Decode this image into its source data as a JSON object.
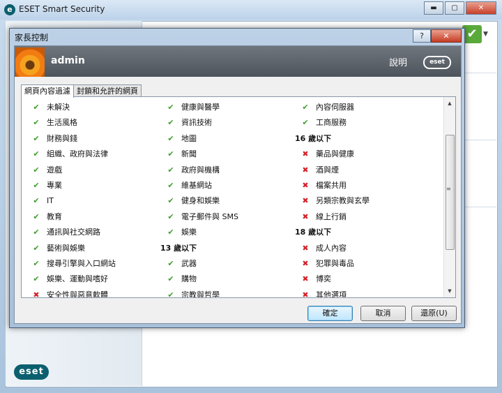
{
  "main_window": {
    "title": "ESET Smart Security",
    "logo_letter": "e",
    "minimize": "▬",
    "maximize": "▢",
    "close": "✕",
    "brand": "eset"
  },
  "dialog": {
    "title": "家長控制",
    "help_button": "?",
    "close_button": "✕",
    "user_name": "admin",
    "help_link": "說明",
    "brand": "eset",
    "tabs": [
      {
        "label": "網頁內容過濾",
        "active": true
      },
      {
        "label": "封鎖和允許的網頁",
        "active": false
      }
    ],
    "columns": [
      [
        {
          "type": "ok",
          "label": "未解決"
        },
        {
          "type": "ok",
          "label": "生活風格"
        },
        {
          "type": "ok",
          "label": "財務與錢"
        },
        {
          "type": "ok",
          "label": "組織、政府與法律"
        },
        {
          "type": "ok",
          "label": "遊戲"
        },
        {
          "type": "ok",
          "label": "專業"
        },
        {
          "type": "ok",
          "label": "IT"
        },
        {
          "type": "ok",
          "label": "教育"
        },
        {
          "type": "ok",
          "label": "通訊與社交網路"
        },
        {
          "type": "ok",
          "label": "藝術與娛樂"
        },
        {
          "type": "ok",
          "label": "搜尋引擎與入口網站"
        },
        {
          "type": "ok",
          "label": "娛樂、運動與嗜好"
        },
        {
          "type": "no",
          "label": "安全性與惡意軟體"
        }
      ],
      [
        {
          "type": "ok",
          "label": "健康與醫學"
        },
        {
          "type": "ok",
          "label": "資訊技術"
        },
        {
          "type": "ok",
          "label": "地圖"
        },
        {
          "type": "ok",
          "label": "新聞"
        },
        {
          "type": "ok",
          "label": "政府與機構"
        },
        {
          "type": "ok",
          "label": "維基網站"
        },
        {
          "type": "ok",
          "label": "健身和娛樂"
        },
        {
          "type": "ok",
          "label": "電子郵件與 SMS"
        },
        {
          "type": "ok",
          "label": "娛樂"
        },
        {
          "type": "hdr",
          "label": "13 歲以下"
        },
        {
          "type": "ok",
          "label": "武器"
        },
        {
          "type": "ok",
          "label": "購物"
        },
        {
          "type": "ok",
          "label": "宗教與哲學"
        }
      ],
      [
        {
          "type": "ok",
          "label": "內容伺服器"
        },
        {
          "type": "ok",
          "label": "工商服務"
        },
        {
          "type": "hdr",
          "label": "16 歲以下"
        },
        {
          "type": "no",
          "label": "藥品與健康"
        },
        {
          "type": "no",
          "label": "酒與煙"
        },
        {
          "type": "no",
          "label": "檔案共用"
        },
        {
          "type": "no",
          "label": "另類宗教與玄學"
        },
        {
          "type": "no",
          "label": "線上行銷"
        },
        {
          "type": "hdr",
          "label": "18 歲以下"
        },
        {
          "type": "no",
          "label": "成人內容"
        },
        {
          "type": "no",
          "label": "犯罪與毒品"
        },
        {
          "type": "no",
          "label": "博奕"
        },
        {
          "type": "no",
          "label": "其他選項"
        }
      ]
    ],
    "icons": {
      "ok": "✔",
      "no": "✖"
    },
    "scroll": {
      "up": "▲",
      "down": "▼",
      "grip": "≡"
    },
    "buttons": {
      "ok": "確定",
      "cancel": "取消",
      "restore": "還原(U)"
    }
  }
}
